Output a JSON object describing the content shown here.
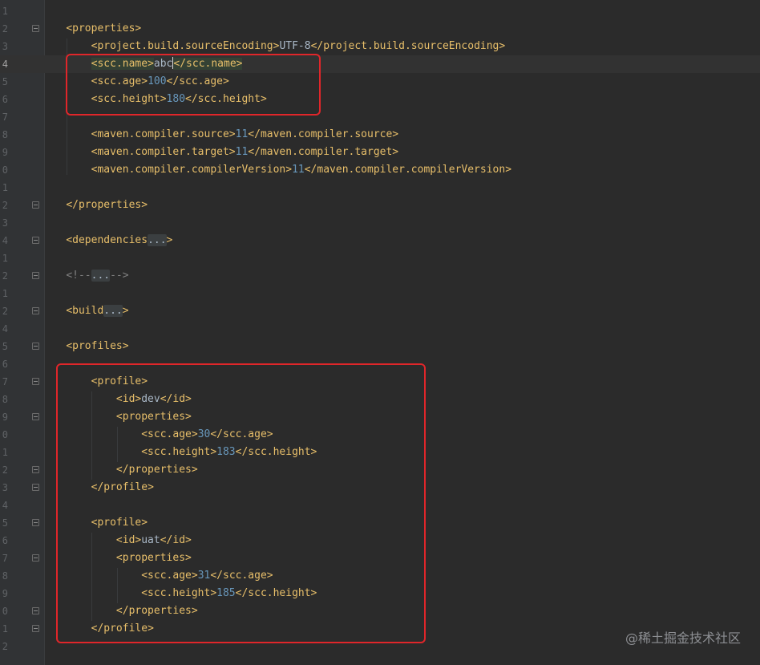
{
  "editor": {
    "lines": [
      {
        "num": "1",
        "html": ""
      },
      {
        "num": "2",
        "html": "    <span class=\"tag\">&lt;properties&gt;</span>",
        "fold": true
      },
      {
        "num": "3",
        "html": "        <span class=\"tag\">&lt;project.build.sourceEncoding&gt;</span><span class=\"txt\">UTF-8</span><span class=\"tag\">&lt;/project.build.sourceEncoding&gt;</span>"
      },
      {
        "num": "4",
        "current": true,
        "html": "        <span class=\"tag tag-hl\">&lt;scc.name&gt;</span><span class=\"txt\">abc</span><span class=\"caret\"></span><span class=\"tag tag-hl\">&lt;/scc.name&gt;</span>"
      },
      {
        "num": "5",
        "html": "        <span class=\"tag\">&lt;scc.age&gt;</span><span class=\"num\">100</span><span class=\"tag\">&lt;/scc.age&gt;</span>"
      },
      {
        "num": "6",
        "html": "        <span class=\"tag\">&lt;scc.height&gt;</span><span class=\"num\">180</span><span class=\"tag\">&lt;/scc.height&gt;</span>"
      },
      {
        "num": "7",
        "html": ""
      },
      {
        "num": "8",
        "html": "        <span class=\"tag\">&lt;maven.compiler.source&gt;</span><span class=\"num\">11</span><span class=\"tag\">&lt;/maven.compiler.source&gt;</span>"
      },
      {
        "num": "9",
        "html": "        <span class=\"tag\">&lt;maven.compiler.target&gt;</span><span class=\"num\">11</span><span class=\"tag\">&lt;/maven.compiler.target&gt;</span>"
      },
      {
        "num": "0",
        "html": "        <span class=\"tag\">&lt;maven.compiler.compilerVersion&gt;</span><span class=\"num\">11</span><span class=\"tag\">&lt;/maven.compiler.compilerVersion&gt;</span>"
      },
      {
        "num": "1",
        "html": ""
      },
      {
        "num": "2",
        "html": "    <span class=\"tag\">&lt;/properties&gt;</span>",
        "fold": true
      },
      {
        "num": "3",
        "html": ""
      },
      {
        "num": "4",
        "html": "    <span class=\"tag\">&lt;dependencies</span><span class=\"folded\">...</span><span class=\"tag\">&gt;</span>",
        "fold": true
      },
      {
        "num": "1",
        "html": ""
      },
      {
        "num": "2",
        "html": "    <span class=\"cmt\">&lt;!--</span><span class=\"folded\">...</span><span class=\"cmt\">--&gt;</span>",
        "fold": true
      },
      {
        "num": "1",
        "html": ""
      },
      {
        "num": "2",
        "html": "    <span class=\"tag\">&lt;build</span><span class=\"folded\">...</span><span class=\"tag\">&gt;</span>",
        "fold": true
      },
      {
        "num": "4",
        "html": ""
      },
      {
        "num": "5",
        "html": "    <span class=\"tag\">&lt;profiles&gt;</span>",
        "fold": true
      },
      {
        "num": "6",
        "html": ""
      },
      {
        "num": "7",
        "html": "        <span class=\"tag\">&lt;profile&gt;</span>",
        "fold": true
      },
      {
        "num": "8",
        "html": "            <span class=\"tag\">&lt;id&gt;</span><span class=\"txt\">dev</span><span class=\"tag\">&lt;/id&gt;</span>"
      },
      {
        "num": "9",
        "html": "            <span class=\"tag\">&lt;properties&gt;</span>",
        "fold": true
      },
      {
        "num": "0",
        "html": "                <span class=\"tag\">&lt;scc.age&gt;</span><span class=\"num\">30</span><span class=\"tag\">&lt;/scc.age&gt;</span>"
      },
      {
        "num": "1",
        "html": "                <span class=\"tag\">&lt;scc.height&gt;</span><span class=\"num\">183</span><span class=\"tag\">&lt;/scc.height&gt;</span>"
      },
      {
        "num": "2",
        "html": "            <span class=\"tag\">&lt;/properties&gt;</span>",
        "fold": true
      },
      {
        "num": "3",
        "html": "        <span class=\"tag\">&lt;/profile&gt;</span>",
        "fold": true
      },
      {
        "num": "4",
        "html": ""
      },
      {
        "num": "5",
        "html": "        <span class=\"tag\">&lt;profile&gt;</span>",
        "fold": true
      },
      {
        "num": "6",
        "html": "            <span class=\"tag\">&lt;id&gt;</span><span class=\"txt\">uat</span><span class=\"tag\">&lt;/id&gt;</span>"
      },
      {
        "num": "7",
        "html": "            <span class=\"tag\">&lt;properties&gt;</span>",
        "fold": true
      },
      {
        "num": "8",
        "html": "                <span class=\"tag\">&lt;scc.age&gt;</span><span class=\"num\">31</span><span class=\"tag\">&lt;/scc.age&gt;</span>"
      },
      {
        "num": "9",
        "html": "                <span class=\"tag\">&lt;scc.height&gt;</span><span class=\"num\">185</span><span class=\"tag\">&lt;/scc.height&gt;</span>"
      },
      {
        "num": "0",
        "html": "            <span class=\"tag\">&lt;/properties&gt;</span>",
        "fold": true
      },
      {
        "num": "1",
        "html": "        <span class=\"tag\">&lt;/profile&gt;</span>",
        "fold": true
      },
      {
        "num": "2",
        "html": ""
      }
    ]
  },
  "watermark": "@稀土掘金技术社区",
  "colors": {
    "background": "#2b2b2b",
    "gutter": "#313335",
    "tag": "#e8bf6a",
    "text": "#a9b7c6",
    "number": "#6897bb",
    "comment": "#808080",
    "highlight_box": "#e0262a"
  }
}
